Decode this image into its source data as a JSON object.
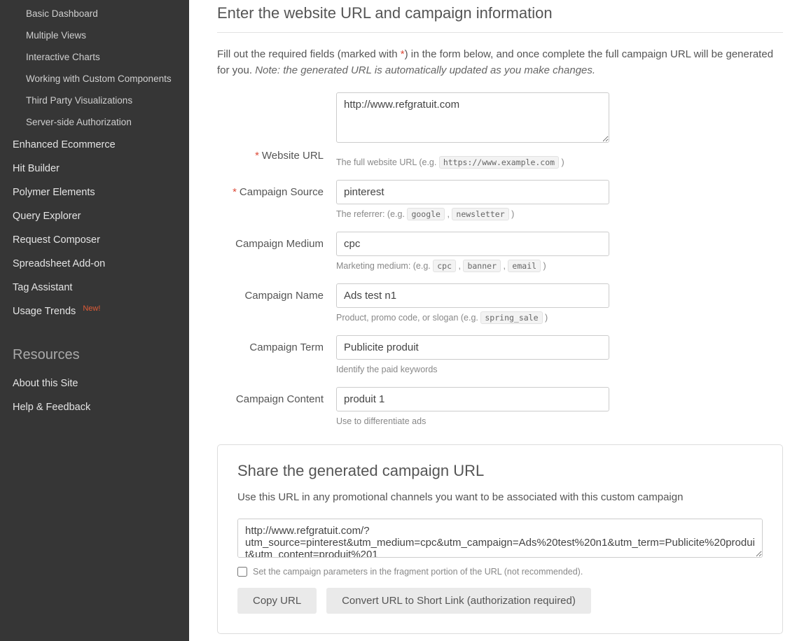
{
  "sidebar": {
    "sub_items": [
      "Basic Dashboard",
      "Multiple Views",
      "Interactive Charts",
      "Working with Custom Components",
      "Third Party Visualizations",
      "Server-side Authorization"
    ],
    "nav_items": [
      {
        "label": "Enhanced Ecommerce"
      },
      {
        "label": "Hit Builder"
      },
      {
        "label": "Polymer Elements"
      },
      {
        "label": "Query Explorer"
      },
      {
        "label": "Request Composer"
      },
      {
        "label": "Spreadsheet Add-on"
      },
      {
        "label": "Tag Assistant"
      },
      {
        "label": "Usage Trends",
        "badge": "New!"
      }
    ],
    "resources_heading": "Resources",
    "resource_items": [
      "About this Site",
      "Help & Feedback"
    ]
  },
  "main": {
    "title": "Enter the website URL and campaign information",
    "intro_pre": "Fill out the required fields (marked with ",
    "intro_post": ") in the form below, and once complete the full campaign URL will be generated for you. ",
    "intro_note": "Note: the generated URL is automatically updated as you make changes.",
    "asterisk": "*"
  },
  "form": {
    "website_url": {
      "label": "Website URL",
      "required": true,
      "value": "http://www.refgratuit.com",
      "help_pre": "The full website URL (e.g. ",
      "help_code": "https://www.example.com",
      "help_post": " )"
    },
    "campaign_source": {
      "label": "Campaign Source",
      "required": true,
      "value": "pinterest",
      "help_pre": "The referrer: (e.g. ",
      "help_codes": [
        "google",
        "newsletter"
      ],
      "help_post": " )"
    },
    "campaign_medium": {
      "label": "Campaign Medium",
      "required": false,
      "value": "cpc",
      "help_pre": "Marketing medium: (e.g. ",
      "help_codes": [
        "cpc",
        "banner",
        "email"
      ],
      "help_post": " )"
    },
    "campaign_name": {
      "label": "Campaign Name",
      "required": false,
      "value": "Ads test n1",
      "help_pre": "Product, promo code, or slogan (e.g. ",
      "help_codes": [
        "spring_sale"
      ],
      "help_post": " )"
    },
    "campaign_term": {
      "label": "Campaign Term",
      "required": false,
      "value": "Publicite produit",
      "help": "Identify the paid keywords"
    },
    "campaign_content": {
      "label": "Campaign Content",
      "required": false,
      "value": "produit 1",
      "help": "Use to differentiate ads"
    }
  },
  "share": {
    "heading": "Share the generated campaign URL",
    "desc": "Use this URL in any promotional channels you want to be associated with this custom campaign",
    "generated_url": "http://www.refgratuit.com/?utm_source=pinterest&utm_medium=cpc&utm_campaign=Ads%20test%20n1&utm_term=Publicite%20produit&utm_content=produit%201",
    "fragment_checkbox_label": "Set the campaign parameters in the fragment portion of the URL (not recommended).",
    "copy_btn": "Copy URL",
    "shorten_btn": "Convert URL to Short Link (authorization required)"
  }
}
